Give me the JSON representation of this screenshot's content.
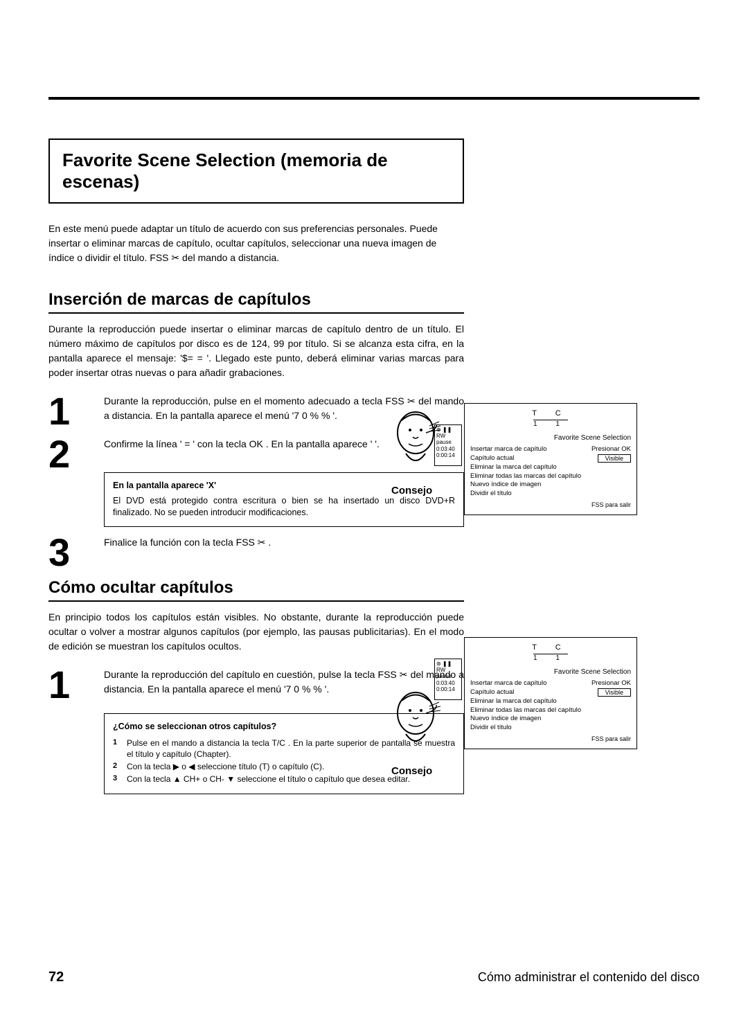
{
  "page": {
    "number": "72",
    "footer": "Cómo administrar el contenido del disco"
  },
  "title": "Favorite Scene Selection (memoria de escenas)",
  "intro": "En este menú puede adaptar un título de acuerdo con sus preferencias personales. Puede insertar o eliminar marcas de capítulo, ocultar capítulos, seleccionar una nueva imagen de índice o dividir el título. FSS ✂ del mando a distancia.",
  "sec1": {
    "heading": "Inserción de marcas de capítulos",
    "para": "Durante la reproducción puede insertar o eliminar marcas de capítulo dentro de un título. El número máximo de capítulos por disco es de 124, 99 por título. Si se alcanza esta cifra, en la pantalla aparece el mensaje: '$=               =   '. Llegado este punto, deberá eliminar varias marcas para poder insertar otras nuevas o para añadir grabaciones.",
    "step1": "Durante la reproducción, pulse en el momento adecuado a tecla FSS ✂ del mando a distancia. En la pantalla aparece el menú '7 0      %      %       '.",
    "step2": "Confirme la línea '                               =   ' con la tecla OK . En la pantalla aparece '                                   '.",
    "tip_head": "En la pantalla aparece 'X'",
    "tip_body": "El DVD está protegido contra escritura o bien se ha insertado un disco DVD+R finalizado. No se pueden introducir modificaciones.",
    "step3": "Finalice la función con la tecla FSS ✂ .",
    "consejo": "Consejo"
  },
  "sec2": {
    "heading": "Cómo ocultar capítulos",
    "para": "En principio todos los capítulos están visibles. No obstante, durante la reproducción puede ocultar o volver a mostrar algunos capítulos (por ejemplo, las pausas publicitarias). En el modo de edición se muestran los capítulos ocultos.",
    "step1": "Durante la reproducción del capítulo en cuestión, pulse la tecla FSS ✂ del mando a distancia. En la pantalla aparece el menú '7 0      %      %       '.",
    "tip_head": "¿Cómo se seleccionan otros capítulos?",
    "tip1": "Pulse en el mando a distancia la tecla T/C . En la parte superior de pantalla se muestra el título y capítulo (Chapter).",
    "tip2": "Con la tecla ▶ o ◀ seleccione título (T) o capítulo (C).",
    "tip3": "Con la tecla ▲ CH+ o CH- ▼ seleccione el título o capítulo que desea editar.",
    "consejo": "Consejo"
  },
  "osd": {
    "tc": "T   C",
    "nums": "1   1",
    "title": "Favorite Scene Selection",
    "rows": {
      "r1a": "Insertar marca de capítulo",
      "r1b": "Presionar OK",
      "r2a": "Capítulo actual",
      "r2b": "Visible",
      "r3": "Eliminar la marca del capítulo",
      "r4": "Eliminar todas las marcas del capítulo",
      "r5": "Nuevo índice de imagen",
      "r6": "Dividir el título"
    },
    "footer": "FSS para salir",
    "side": {
      "l1": "⊛ ❚❚",
      "l2": "RW pause",
      "l3": "0:03:40",
      "l4": "0:00:14"
    }
  }
}
